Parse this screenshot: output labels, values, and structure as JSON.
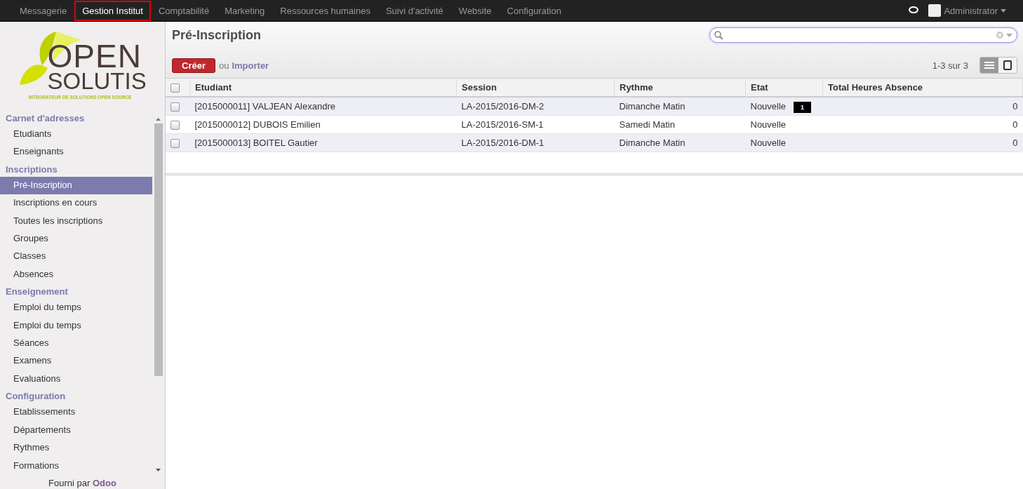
{
  "top_menu": [
    {
      "label": "Messagerie",
      "selected": false
    },
    {
      "label": "Gestion Institut",
      "selected": true
    },
    {
      "label": "Comptabilité",
      "selected": false
    },
    {
      "label": "Marketing",
      "selected": false
    },
    {
      "label": "Ressources humaines",
      "selected": false
    },
    {
      "label": "Suivi d'activité",
      "selected": false
    },
    {
      "label": "Website",
      "selected": false
    },
    {
      "label": "Configuration",
      "selected": false
    }
  ],
  "user": {
    "name": "Administrator"
  },
  "logo": {
    "line1": "OPEN",
    "line2": "SOLUTIS",
    "tagline": "INTEGRATEUR DE SOLUTIONS OPEN SOURCE"
  },
  "sidebar": {
    "sections": [
      {
        "title": "Carnet d'adresses",
        "items": [
          {
            "label": "Etudiants",
            "selected": false
          },
          {
            "label": "Enseignants",
            "selected": false
          }
        ]
      },
      {
        "title": "Inscriptions",
        "items": [
          {
            "label": "Pré-Inscription",
            "selected": true
          },
          {
            "label": "Inscriptions en cours",
            "selected": false
          },
          {
            "label": "Toutes les inscriptions",
            "selected": false
          },
          {
            "label": "Groupes",
            "selected": false
          },
          {
            "label": "Classes",
            "selected": false
          },
          {
            "label": "Absences",
            "selected": false
          }
        ]
      },
      {
        "title": "Enseignement",
        "items": [
          {
            "label": "Emploi du temps",
            "selected": false
          },
          {
            "label": "Emploi du temps",
            "selected": false
          },
          {
            "label": "Séances",
            "selected": false
          },
          {
            "label": "Examens",
            "selected": false
          },
          {
            "label": "Evaluations",
            "selected": false
          }
        ]
      },
      {
        "title": "Configuration",
        "items": [
          {
            "label": "Etablissements",
            "selected": false
          },
          {
            "label": "Départements",
            "selected": false
          },
          {
            "label": "Rythmes",
            "selected": false
          },
          {
            "label": "Formations",
            "selected": false
          }
        ]
      }
    ],
    "footer": {
      "text": "Fourni par",
      "link": "Odoo"
    }
  },
  "page": {
    "title": "Pré-Inscription",
    "create_button": "Créer",
    "or_text": "ou",
    "import_link": "Importer",
    "pager": "1-3 sur 3",
    "views": [
      {
        "kind": "list",
        "selected": true
      },
      {
        "kind": "form",
        "selected": false
      }
    ]
  },
  "table": {
    "columns": [
      "Etudiant",
      "Session",
      "Rythme",
      "Etat",
      "Total Heures Absence"
    ],
    "all_checked": false,
    "rows": [
      {
        "checked": false,
        "cells": [
          "[2015000011] VALJEAN Alexandre",
          "LA-2015/2016-DM-2",
          "Dimanche Matin",
          "Nouvelle",
          "0"
        ],
        "badge": "1"
      },
      {
        "checked": false,
        "cells": [
          "[2015000012] DUBOIS Emilien",
          "LA-2015/2016-SM-1",
          "Samedi Matin",
          "Nouvelle",
          "0"
        ]
      },
      {
        "checked": false,
        "cells": [
          "[2015000013] BOITEL Gautier",
          "LA-2015/2016-DM-1",
          "Dimanche Matin",
          "Nouvelle",
          "0"
        ]
      }
    ]
  }
}
